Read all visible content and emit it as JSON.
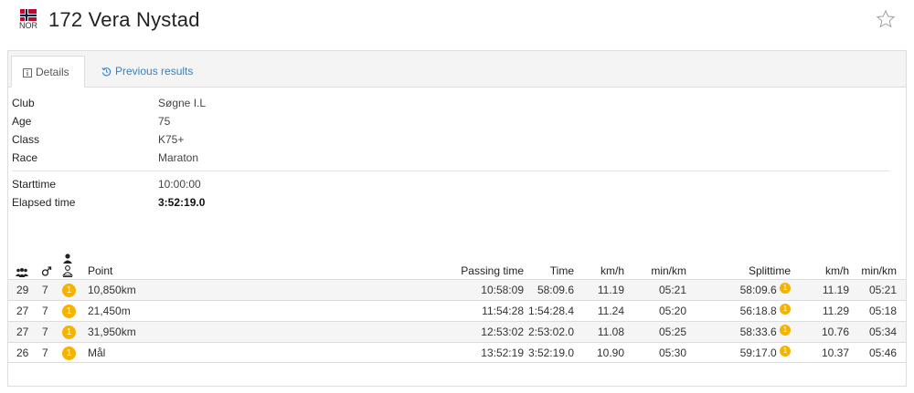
{
  "header": {
    "country_code": "NOR",
    "title": "172 Vera Nystad",
    "star_icon": "star-outline-icon"
  },
  "tabs": [
    {
      "label": "Details",
      "icon": "info-icon"
    },
    {
      "label": "Previous results",
      "icon": "history-icon"
    }
  ],
  "details": {
    "club_label": "Club",
    "club_value": "Søgne I.L",
    "age_label": "Age",
    "age_value": "75",
    "class_label": "Class",
    "class_value": "K75+",
    "race_label": "Race",
    "race_value": "Maraton",
    "starttime_label": "Starttime",
    "starttime_value": "10:00:00",
    "elapsed_label": "Elapsed time",
    "elapsed_value": "3:52:19.0"
  },
  "results": {
    "columns": {
      "point": "Point",
      "passing_time": "Passing time",
      "time": "Time",
      "kmh": "km/h",
      "minkm": "min/km",
      "splittime": "Splittime",
      "split_kmh": "km/h",
      "split_minkm": "min/km"
    },
    "rows": [
      {
        "overall": "29",
        "gender": "7",
        "class_rank": "1",
        "point": "10,850km",
        "passing": "10:58:09",
        "time": "58:09.6",
        "kmh": "11.19",
        "minkm": "05:21",
        "split": "58:09.6",
        "split_rank": "1",
        "split_kmh": "11.19",
        "split_minkm": "05:21"
      },
      {
        "overall": "27",
        "gender": "7",
        "class_rank": "1",
        "point": "21,450m",
        "passing": "11:54:28",
        "time": "1:54:28.4",
        "kmh": "11.24",
        "minkm": "05:20",
        "split": "56:18.8",
        "split_rank": "1",
        "split_kmh": "11.29",
        "split_minkm": "05:18"
      },
      {
        "overall": "27",
        "gender": "7",
        "class_rank": "1",
        "point": "31,950km",
        "passing": "12:53:02",
        "time": "2:53:02.0",
        "kmh": "11.08",
        "minkm": "05:25",
        "split": "58:33.6",
        "split_rank": "1",
        "split_kmh": "10.76",
        "split_minkm": "05:34"
      },
      {
        "overall": "26",
        "gender": "7",
        "class_rank": "1",
        "point": "Mål",
        "passing": "13:52:19",
        "time": "3:52:19.0",
        "kmh": "10.90",
        "minkm": "05:30",
        "split": "59:17.0",
        "split_rank": "1",
        "split_kmh": "10.37",
        "split_minkm": "05:46"
      }
    ]
  },
  "colors": {
    "rank_badge": "#f5b300",
    "link": "#3a7fc1",
    "flag_red": "#ba0c2f",
    "flag_blue": "#00205b"
  }
}
